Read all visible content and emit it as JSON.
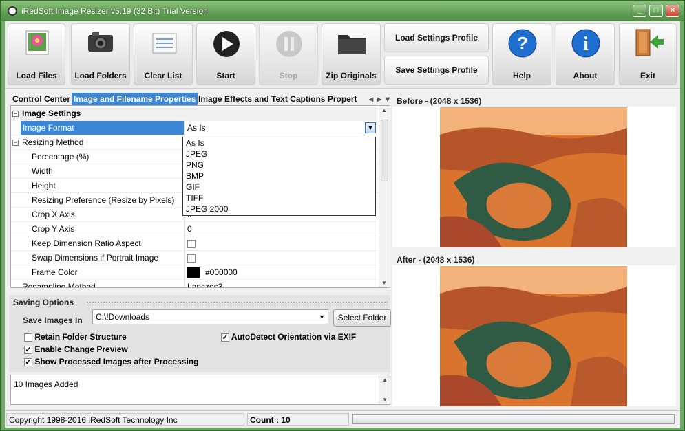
{
  "window": {
    "title": "iRedSoft Image Resizer v5.19 (32 Bit) Trial Version",
    "controls": [
      "_",
      "□",
      "×"
    ]
  },
  "toolbar": {
    "load_files": "Load Files",
    "load_folders": "Load Folders",
    "clear_list": "Clear List",
    "start": "Start",
    "stop": "Stop",
    "zip_originals": "Zip Originals",
    "load_profile": "Load Settings Profile",
    "save_profile": "Save Settings Profile",
    "help": "Help",
    "about": "About",
    "exit": "Exit"
  },
  "tabs": [
    {
      "label": "Control Center"
    },
    {
      "label": "Image and Filename Properties"
    },
    {
      "label": "Image Effects and Text Captions Propert"
    }
  ],
  "grid": {
    "category": "Image Settings",
    "rows": [
      {
        "name": "Image Format",
        "value": "As Is"
      },
      {
        "name": "Resizing Method",
        "value": ""
      },
      {
        "name": "Percentage (%)",
        "value": ""
      },
      {
        "name": "Width",
        "value": ""
      },
      {
        "name": "Height",
        "value": ""
      },
      {
        "name": "Resizing Preference (Resize by Pixels)",
        "value": ""
      },
      {
        "name": "Crop X Axis",
        "value": "0"
      },
      {
        "name": "Crop Y Axis",
        "value": "0"
      },
      {
        "name": "Keep Dimension Ratio Aspect",
        "value": ""
      },
      {
        "name": "Swap Dimensions if Portrait Image",
        "value": ""
      },
      {
        "name": "Frame Color",
        "value": "#000000"
      },
      {
        "name": "Resampling Method",
        "value": "Lanczos3"
      }
    ],
    "dropdown_options": [
      "As Is",
      "JPEG",
      "PNG",
      "BMP",
      "GIF",
      "TIFF",
      "JPEG 2000"
    ]
  },
  "saving": {
    "title": "Saving Options",
    "save_label": "Save Images In",
    "path": "C:\\!Downloads",
    "select_folder": "Select Folder",
    "retain": "Retain Folder Structure",
    "enable_preview": "Enable Change Preview",
    "show_processed": "Show Processed Images after Processing",
    "autodetect": "AutoDetect Orientation via EXIF"
  },
  "log": {
    "text": "10 Images Added"
  },
  "status": {
    "copyright": "Copyright 1998-2016 iRedSoft Technology Inc",
    "count": "Count : 10"
  },
  "preview": {
    "before": "Before - (2048 x 1536)",
    "after": "After - (2048 x 1536)"
  },
  "colors": {
    "title_bar": "#6fa864",
    "selection": "#3b87d6"
  }
}
